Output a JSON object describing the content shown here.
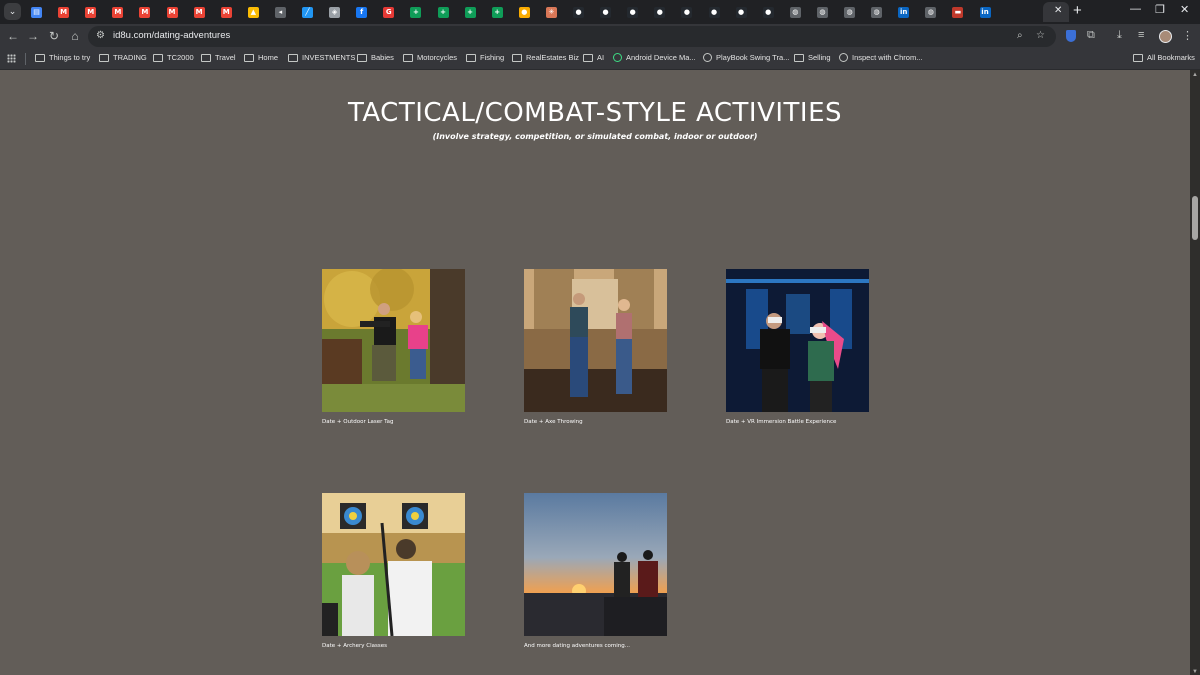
{
  "browser": {
    "url": "id8u.com/dating-adventures",
    "tabs": [
      {
        "icon": "google-docs-icon",
        "color": "#4285f4",
        "glyph": "▤"
      },
      {
        "icon": "gmail-icon",
        "color": "#ea4335",
        "glyph": "M"
      },
      {
        "icon": "gmail-icon",
        "color": "#ea4335",
        "glyph": "M"
      },
      {
        "icon": "gmail-icon",
        "color": "#ea4335",
        "glyph": "M"
      },
      {
        "icon": "gmail-icon",
        "color": "#ea4335",
        "glyph": "M"
      },
      {
        "icon": "gmail-icon",
        "color": "#ea4335",
        "glyph": "M"
      },
      {
        "icon": "gmail-icon",
        "color": "#ea4335",
        "glyph": "M"
      },
      {
        "icon": "gmail-icon",
        "color": "#ea4335",
        "glyph": "M"
      },
      {
        "icon": "google-drive-icon",
        "color": "#fbbc04",
        "glyph": "▲"
      },
      {
        "icon": "audio-icon",
        "color": "#5f6368",
        "glyph": "◂"
      },
      {
        "icon": "chart-icon",
        "color": "#2196f3",
        "glyph": "╱"
      },
      {
        "icon": "shield-icon",
        "color": "#9aa0a6",
        "glyph": "◈"
      },
      {
        "icon": "facebook-icon",
        "color": "#1877f2",
        "glyph": "f"
      },
      {
        "icon": "app-icon",
        "color": "#e53935",
        "glyph": "G"
      },
      {
        "icon": "sheets-icon",
        "color": "#0f9d58",
        "glyph": "+"
      },
      {
        "icon": "sheets-icon",
        "color": "#0f9d58",
        "glyph": "+"
      },
      {
        "icon": "sheets-icon",
        "color": "#0f9d58",
        "glyph": "+"
      },
      {
        "icon": "sheets-icon",
        "color": "#0f9d58",
        "glyph": "+"
      },
      {
        "icon": "sun-icon",
        "color": "#f9ab00",
        "glyph": "●"
      },
      {
        "icon": "claude-icon",
        "color": "#d97757",
        "glyph": "✳"
      },
      {
        "icon": "github-icon",
        "color": "#24292f",
        "glyph": "●"
      },
      {
        "icon": "github-icon",
        "color": "#24292f",
        "glyph": "●"
      },
      {
        "icon": "github-icon",
        "color": "#24292f",
        "glyph": "●"
      },
      {
        "icon": "github-icon",
        "color": "#24292f",
        "glyph": "●"
      },
      {
        "icon": "github-icon",
        "color": "#24292f",
        "glyph": "●"
      },
      {
        "icon": "github-icon",
        "color": "#24292f",
        "glyph": "●"
      },
      {
        "icon": "github-icon",
        "color": "#24292f",
        "glyph": "●"
      },
      {
        "icon": "github-icon",
        "color": "#24292f",
        "glyph": "●"
      },
      {
        "icon": "globe-icon",
        "color": "#5f6368",
        "glyph": "◍"
      },
      {
        "icon": "globe-icon",
        "color": "#5f6368",
        "glyph": "◍"
      },
      {
        "icon": "globe-icon",
        "color": "#5f6368",
        "glyph": "◍"
      },
      {
        "icon": "globe-icon",
        "color": "#5f6368",
        "glyph": "◍"
      },
      {
        "icon": "linkedin-icon",
        "color": "#0a66c2",
        "glyph": "in"
      },
      {
        "icon": "globe-icon",
        "color": "#5f6368",
        "glyph": "◍"
      },
      {
        "icon": "flag-icon",
        "color": "#c0392b",
        "glyph": "▬"
      },
      {
        "icon": "linkedin-icon",
        "color": "#0a66c2",
        "glyph": "in"
      }
    ],
    "bookmarks": [
      {
        "label": "Things to try",
        "kind": "folder"
      },
      {
        "label": "TRADING",
        "kind": "folder"
      },
      {
        "label": "TC2000",
        "kind": "folder"
      },
      {
        "label": "Travel",
        "kind": "folder"
      },
      {
        "label": "Home",
        "kind": "folder"
      },
      {
        "label": "INVESTMENTS",
        "kind": "folder"
      },
      {
        "label": "Babies",
        "kind": "folder"
      },
      {
        "label": "Motorcycles",
        "kind": "folder"
      },
      {
        "label": "Fishing",
        "kind": "folder"
      },
      {
        "label": "RealEstates Biz",
        "kind": "folder"
      },
      {
        "label": "AI",
        "kind": "folder"
      },
      {
        "label": "Android Device Ma...",
        "kind": "android"
      },
      {
        "label": "PlayBook Swing Tra...",
        "kind": "globe"
      },
      {
        "label": "Selling",
        "kind": "folder"
      },
      {
        "label": "Inspect with Chrom...",
        "kind": "globe"
      }
    ],
    "all_bookmarks": "All Bookmarks"
  },
  "page": {
    "title": "TACTICAL/COMBAT-STYLE ACTIVITIES",
    "subtitle": "(Involve strategy, competition, or simulated combat, indoor or outdoor)",
    "cards": [
      {
        "caption": "Date + Outdoor Laser Tag",
        "image": "laser-tag-photo"
      },
      {
        "caption": "Date + Axe Throwing",
        "image": "axe-throwing-photo"
      },
      {
        "caption": "Date + VR Immersion Battle Experience",
        "image": "vr-battle-photo"
      },
      {
        "caption": "Date + Archery Classes",
        "image": "archery-photo"
      },
      {
        "caption": "And more dating adventures coming...",
        "image": "sunset-photo"
      }
    ]
  }
}
